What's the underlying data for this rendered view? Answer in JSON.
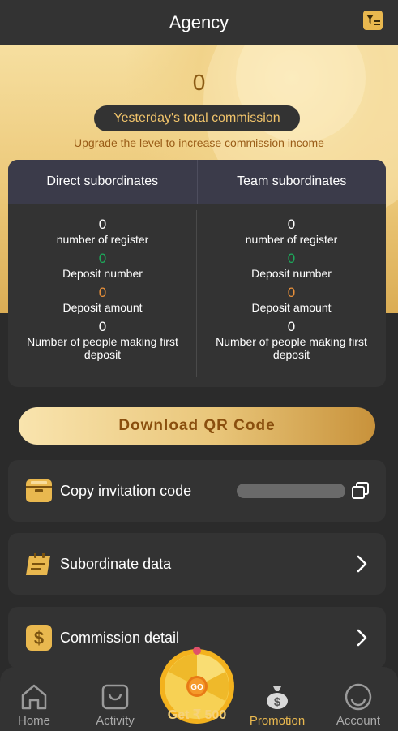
{
  "header": {
    "title": "Agency",
    "filter_icon": "filter-icon"
  },
  "hero": {
    "commission_value": "0",
    "commission_label": "Yesterday's total commission",
    "upgrade_text": "Upgrade the level to increase commission income"
  },
  "stats": {
    "direct": {
      "title": "Direct subordinates",
      "register_count": "0",
      "register_label": "number of register",
      "deposit_number": "0",
      "deposit_number_label": "Deposit number",
      "deposit_amount": "0",
      "deposit_amount_label": "Deposit amount",
      "first_deposit": "0",
      "first_deposit_label": "Number of people making first deposit"
    },
    "team": {
      "title": "Team subordinates",
      "register_count": "0",
      "register_label": "number of register",
      "deposit_number": "0",
      "deposit_number_label": "Deposit number",
      "deposit_amount": "0",
      "deposit_amount_label": "Deposit amount",
      "first_deposit": "0",
      "first_deposit_label": "Number of people making first deposit"
    }
  },
  "actions": {
    "download_qr": "Download QR Code",
    "copy_invitation": "Copy invitation code",
    "subordinate_data": "Subordinate data",
    "commission_detail": "Commission detail"
  },
  "tabbar": {
    "home": "Home",
    "activity": "Activity",
    "promo_bonus": "Get ₹ 500",
    "wheel_go": "GO",
    "promotion": "Promotion",
    "account": "Account",
    "active_tab": "Promotion"
  },
  "colors": {
    "accent_gold": "#e9b84f",
    "background": "#2b2b2b",
    "card": "#333333",
    "green": "#1dab5b",
    "orange": "#e8903a"
  }
}
